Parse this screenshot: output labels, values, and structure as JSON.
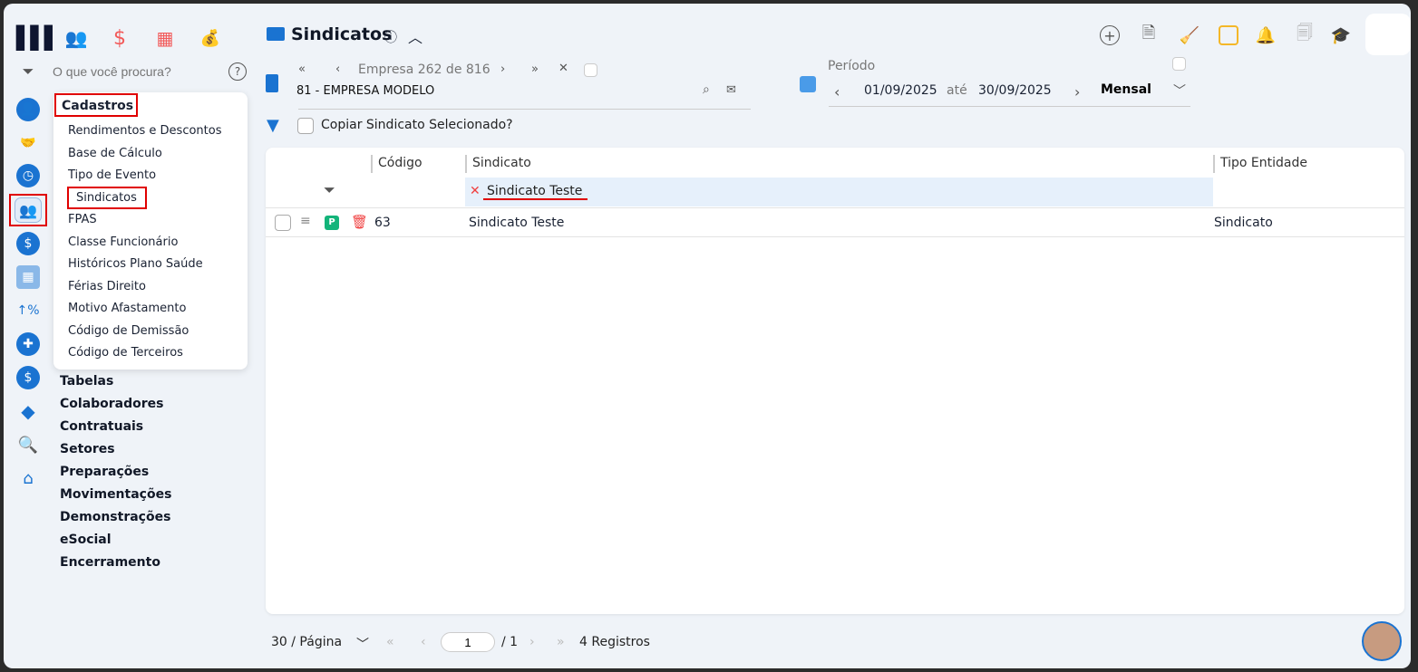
{
  "app": {
    "logo": "logo-icon"
  },
  "top_modules": [
    {
      "icon": "users-icon"
    },
    {
      "icon": "dollar-icon"
    },
    {
      "icon": "calculator-icon"
    },
    {
      "icon": "money-bag-icon"
    }
  ],
  "search": {
    "placeholder": "O que você procura?"
  },
  "side_icons": [
    "user-gear",
    "handshake",
    "clock",
    "users",
    "dollar",
    "calculator",
    "arrow-percent",
    "gear",
    "money-bag",
    "layers",
    "search",
    "home"
  ],
  "menu": {
    "title": "Cadastros",
    "items": [
      "Rendimentos e Descontos",
      "Base de Cálculo",
      "Tipo de Evento",
      "Sindicatos",
      "FPAS",
      "Classe Funcionário",
      "Históricos Plano Saúde",
      "Férias Direito",
      "Motivo Afastamento",
      "Código de Demissão",
      "Código de Terceiros"
    ]
  },
  "categories": [
    "Tabelas",
    "Colaboradores",
    "Contratuais",
    "Setores",
    "Preparações",
    "Movimentações",
    "Demonstrações",
    "eSocial",
    "Encerramento"
  ],
  "page": {
    "title": "Sindicatos",
    "info": "ⓘ"
  },
  "empresa": {
    "nav": "Empresa 262 de 816",
    "name": "81 - EMPRESA MODELO"
  },
  "periodo": {
    "label": "Período",
    "start": "01/09/2025",
    "sep": "até",
    "end": "30/09/2025",
    "mode": "Mensal"
  },
  "copy": {
    "label": "Copiar Sindicato Selecionado?"
  },
  "table": {
    "headers": [
      "Código",
      "Sindicato",
      "Tipo Entidade"
    ],
    "filter_value": "Sindicato Teste",
    "rows": [
      {
        "badge": "P",
        "codigo": "63",
        "sindicato": "Sindicato Teste",
        "tipo": "Sindicato"
      }
    ]
  },
  "pagination": {
    "per_page": "30 / Página",
    "page": "1",
    "total_pages": "/ 1",
    "records": "4 Registros"
  },
  "colors": {
    "accent": "#1a73d1",
    "red": "#e00000",
    "badge": "#13b47a"
  }
}
